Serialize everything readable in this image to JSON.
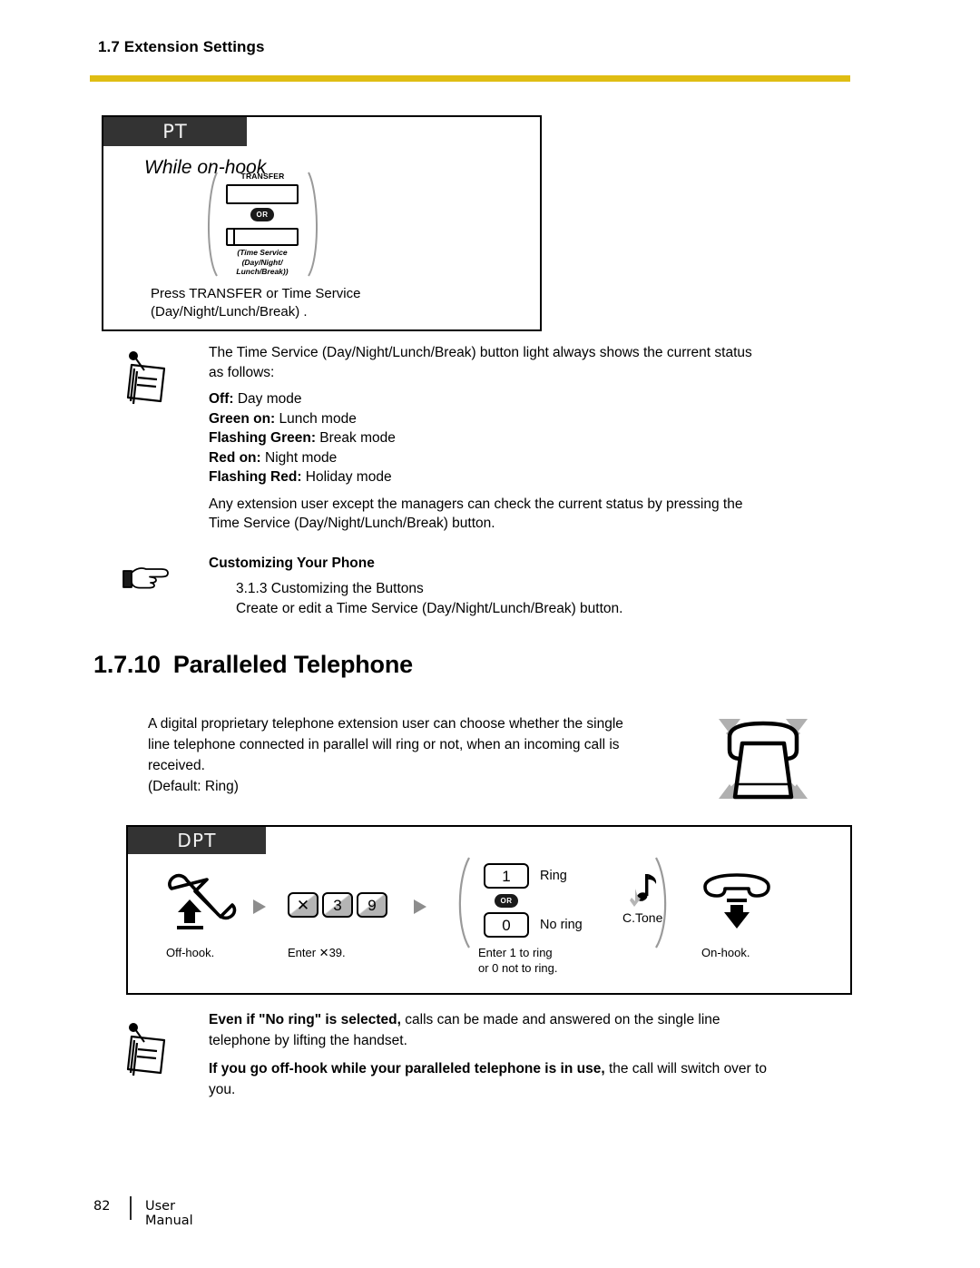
{
  "header": {
    "running_head": "1.7 Extension Settings",
    "rule_color": "#dfbd13"
  },
  "pt_box": {
    "tab_label": "PT",
    "condition": "While on-hook",
    "keys": {
      "transfer_label": "TRANSFER",
      "or_badge": "OR",
      "time_service_caption": "(Time Service (Day/Night/ Lunch/Break))",
      "time_service_caption_line1": "(Time Service",
      "time_service_caption_line2": "(Day/Night/",
      "time_service_caption_line3": "Lunch/Break))"
    },
    "instruction_line1": "Press TRANSFER or Time Service",
    "instruction_line2": "(Day/Night/Lunch/Break)   ."
  },
  "note1": {
    "intro_line1": "The Time Service (Day/Night/Lunch/Break) button light always shows the current status",
    "intro_line2": "as follows:",
    "status_list": [
      {
        "state": "Off:",
        "mode": " Day mode"
      },
      {
        "state": "Green on:",
        "mode": " Lunch mode"
      },
      {
        "state": "Flashing Green:",
        "mode": " Break mode"
      },
      {
        "state": "Red on:",
        "mode": " Night mode"
      },
      {
        "state": "Flashing Red:",
        "mode": " Holiday mode"
      }
    ],
    "closing_line1": "Any extension user except the managers can check the current status by pressing the",
    "closing_line2": "Time Service (Day/Night/Lunch/Break) button."
  },
  "customizing": {
    "title": "Customizing Your Phone",
    "ref_line": "3.1.3 Customizing the Buttons",
    "desc_line": "Create or edit a Time Service (Day/Night/Lunch/Break) button."
  },
  "section": {
    "number": "1.7.10",
    "title": "Paralleled Telephone"
  },
  "intro": {
    "line1": "A digital proprietary telephone extension user can choose whether the single",
    "line2": "line telephone connected in parallel will ring or not, when an incoming call is",
    "line3": "received.",
    "line4": "(Default: Ring)"
  },
  "dpt_box": {
    "tab_label": "DPT",
    "steps": [
      {
        "caption_line1": "Off-hook.",
        "caption_line2": ""
      },
      {
        "caption_line1": "Enter ✕39.",
        "caption_line2": ""
      },
      {
        "caption_line1": "Enter 1 to ring",
        "caption_line2": "or 0 not to ring."
      },
      {
        "caption_line1": "On-hook.",
        "caption_line2": ""
      }
    ],
    "dial_keys": [
      "✕",
      "3",
      "9"
    ],
    "options": {
      "ring_key": "1",
      "ring_label": "Ring",
      "or_badge": "OR",
      "noring_key": "0",
      "noring_label": "No ring"
    },
    "tone_label": "C.Tone"
  },
  "note2": {
    "item1_bold": "Even if \"No ring\" is selected,",
    "item1_rest": " calls can be made and answered on the single line",
    "item1_line2": "telephone by lifting the handset.",
    "item2_bold": "If you go off-hook while your paralleled telephone is in use,",
    "item2_rest": " the call will switch over to",
    "item2_line2": "you."
  },
  "footer": {
    "page_number": "82",
    "label": "User Manual"
  }
}
